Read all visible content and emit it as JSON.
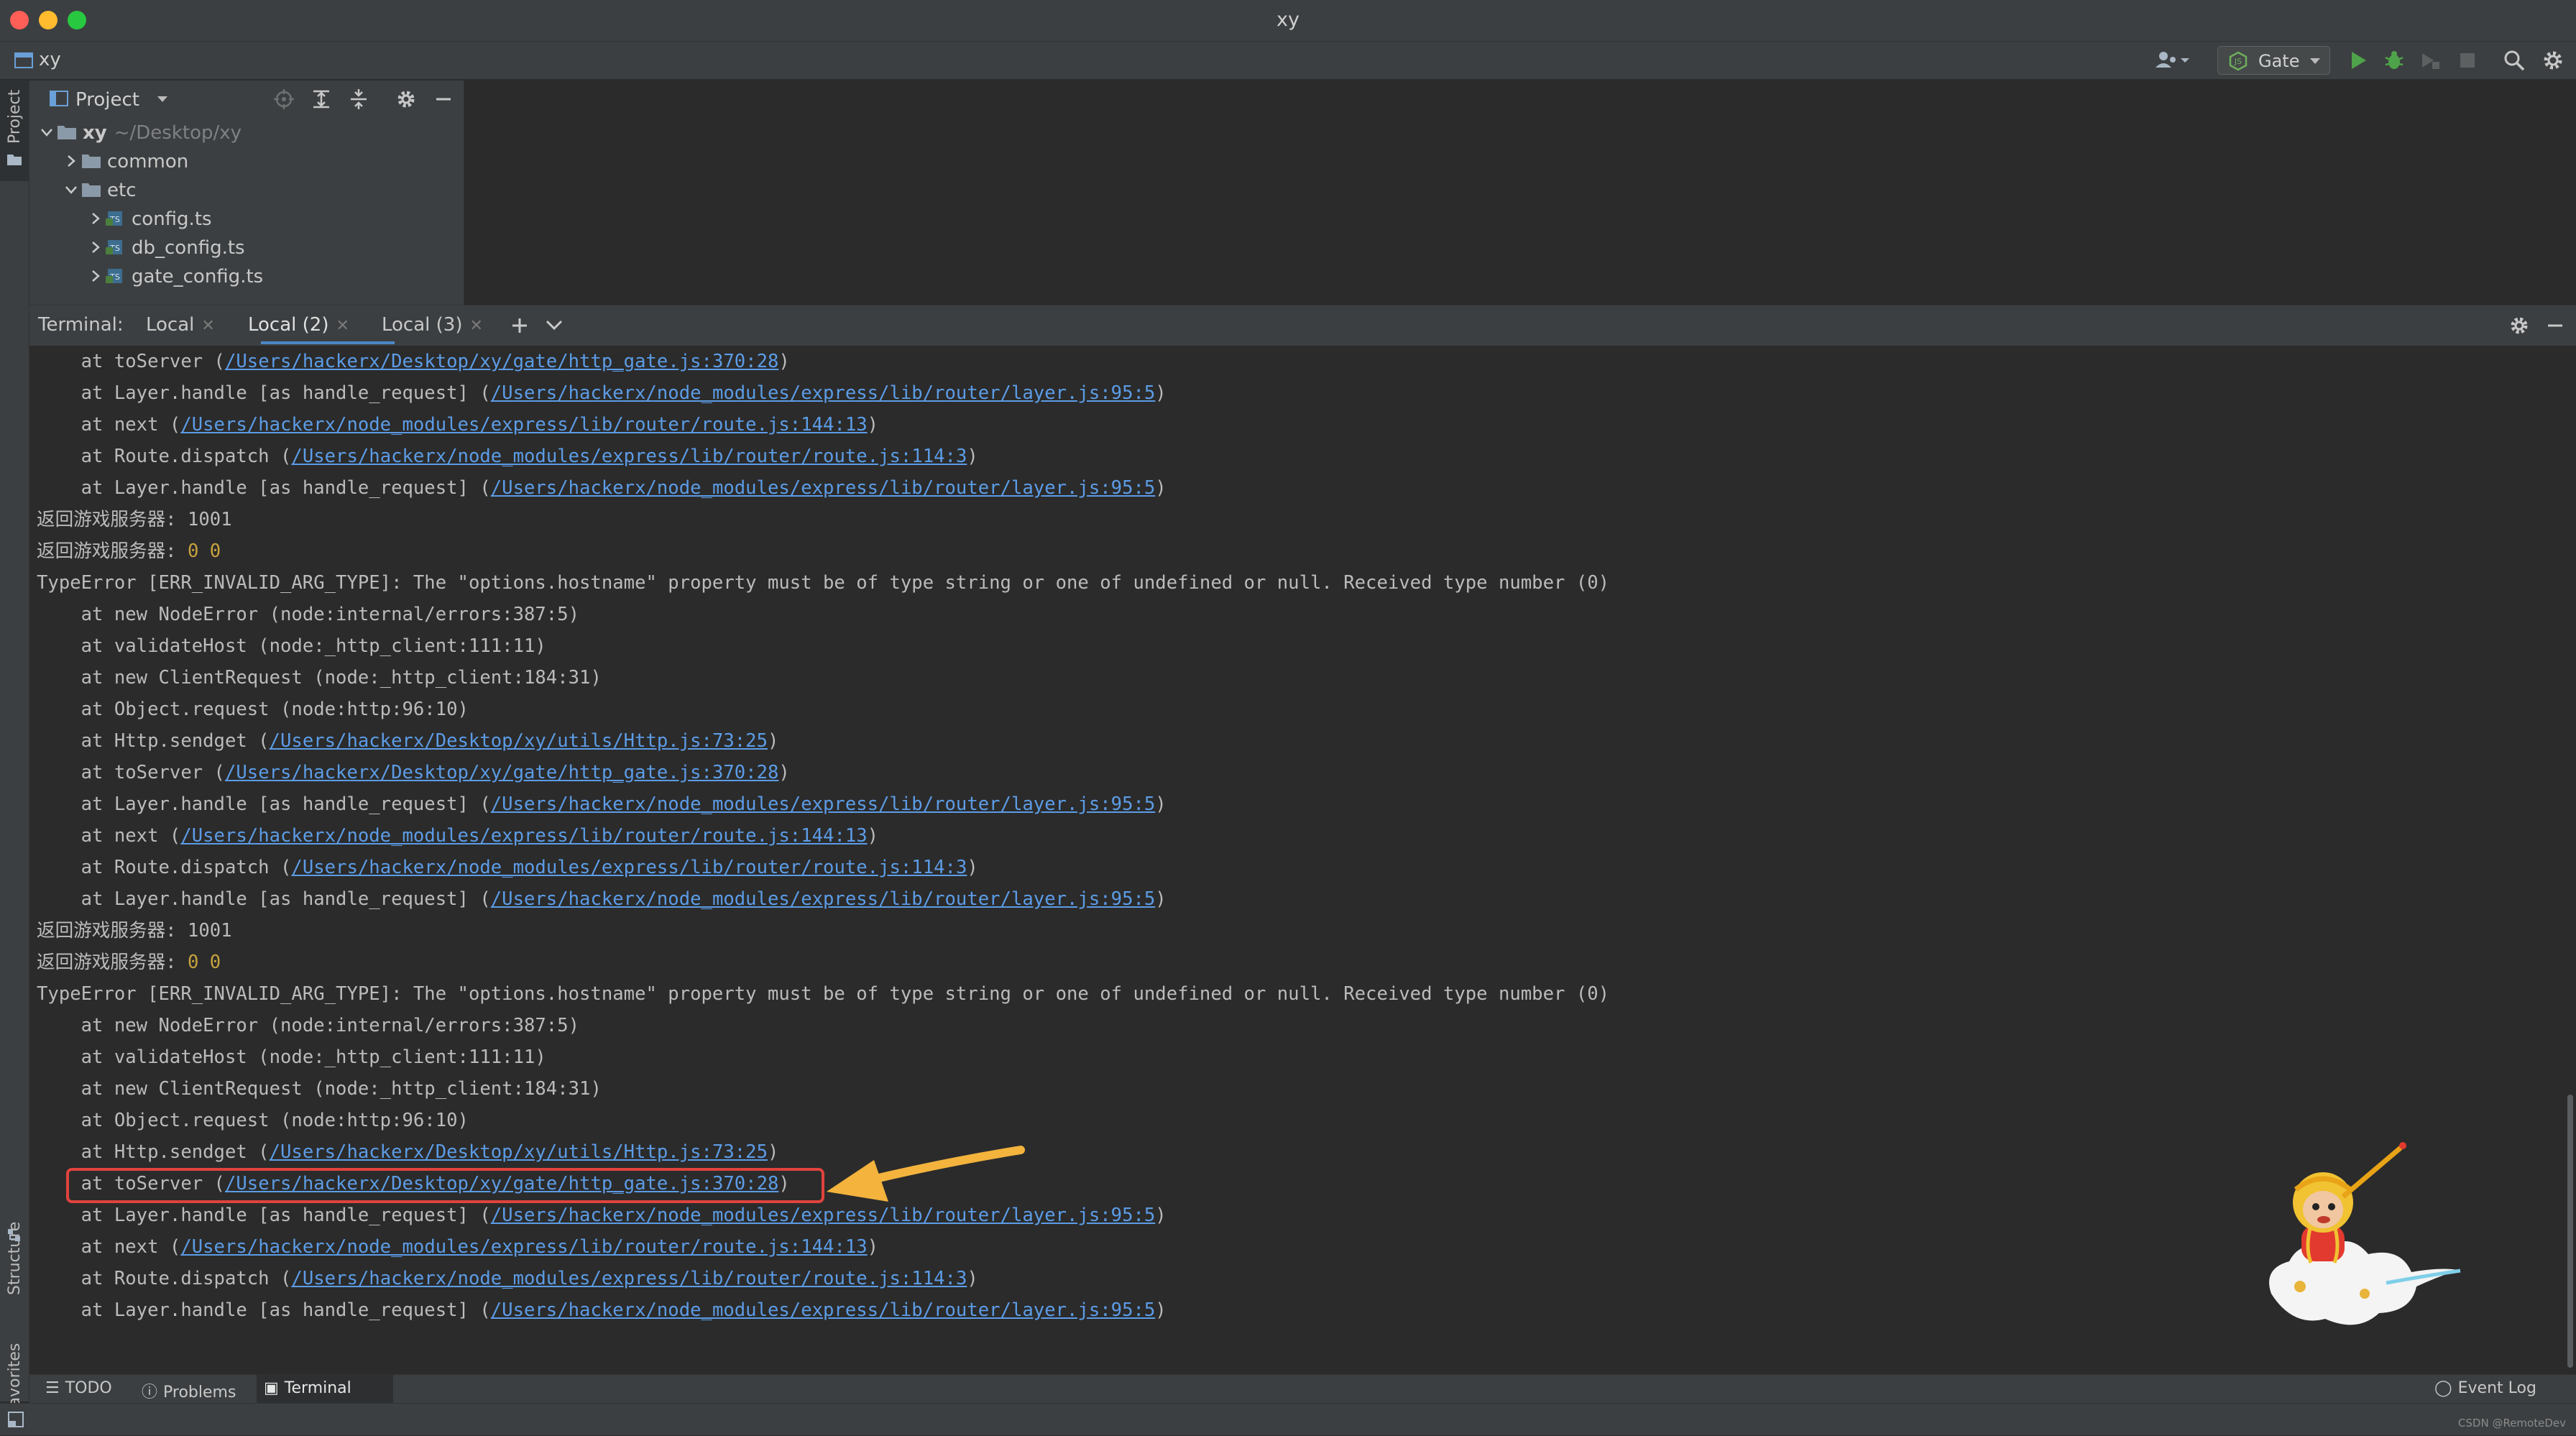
{
  "window": {
    "title": "xy"
  },
  "navbar": {
    "project_name": "xy",
    "run_config": "Gate"
  },
  "left_stripe": {
    "project_tab": "Project",
    "structure_tab": "Structure",
    "favorites_tab": "Favorites"
  },
  "project_panel": {
    "header": "Project",
    "tree": [
      {
        "name": "xy",
        "path": "~/Desktop/xy",
        "level": 0,
        "expanded": true,
        "type": "folder"
      },
      {
        "name": "common",
        "level": 1,
        "expanded": false,
        "type": "folder"
      },
      {
        "name": "etc",
        "level": 1,
        "expanded": true,
        "type": "folder"
      },
      {
        "name": "config.ts",
        "level": 2,
        "expanded": false,
        "type": "ts"
      },
      {
        "name": "db_config.ts",
        "level": 2,
        "expanded": false,
        "type": "ts"
      },
      {
        "name": "gate_config.ts",
        "level": 2,
        "expanded": false,
        "type": "ts"
      }
    ]
  },
  "terminal": {
    "label": "Terminal:",
    "tabs": [
      "Local",
      "Local (2)",
      "Local (3)"
    ],
    "active_tab": 1,
    "lines": [
      {
        "ind": "    ",
        "pre": "at toServer (",
        "link": "/Users/hackerx/Desktop/xy/gate/http_gate.js:370:28",
        "post": ")"
      },
      {
        "ind": "    ",
        "pre": "at Layer.handle [as handle_request] (",
        "link": "/Users/hackerx/node_modules/express/lib/router/layer.js:95:5",
        "post": ")"
      },
      {
        "ind": "    ",
        "pre": "at next (",
        "link": "/Users/hackerx/node_modules/express/lib/router/route.js:144:13",
        "post": ")"
      },
      {
        "ind": "    ",
        "pre": "at Route.dispatch (",
        "link": "/Users/hackerx/node_modules/express/lib/router/route.js:114:3",
        "post": ")"
      },
      {
        "ind": "    ",
        "pre": "at Layer.handle [as handle_request] (",
        "link": "/Users/hackerx/node_modules/express/lib/router/layer.js:95:5",
        "post": ")"
      },
      {
        "pre": "返回游戏服务器: 1001"
      },
      {
        "pre": "返回游戏服务器: ",
        "num": "0 0"
      },
      {
        "pre": "TypeError [ERR_INVALID_ARG_TYPE]: The \"options.hostname\" property must be of type string or one of undefined or null. Received type number (0)"
      },
      {
        "ind": "    ",
        "pre": "at new NodeError (node:internal/errors:387:5)"
      },
      {
        "ind": "    ",
        "pre": "at validateHost (node:_http_client:111:11)"
      },
      {
        "ind": "    ",
        "pre": "at new ClientRequest (node:_http_client:184:31)"
      },
      {
        "ind": "    ",
        "pre": "at Object.request (node:http:96:10)"
      },
      {
        "ind": "    ",
        "pre": "at Http.sendget (",
        "link": "/Users/hackerx/Desktop/xy/utils/Http.js:73:25",
        "post": ")"
      },
      {
        "ind": "    ",
        "pre": "at toServer (",
        "link": "/Users/hackerx/Desktop/xy/gate/http_gate.js:370:28",
        "post": ")"
      },
      {
        "ind": "    ",
        "pre": "at Layer.handle [as handle_request] (",
        "link": "/Users/hackerx/node_modules/express/lib/router/layer.js:95:5",
        "post": ")"
      },
      {
        "ind": "    ",
        "pre": "at next (",
        "link": "/Users/hackerx/node_modules/express/lib/router/route.js:144:13",
        "post": ")"
      },
      {
        "ind": "    ",
        "pre": "at Route.dispatch (",
        "link": "/Users/hackerx/node_modules/express/lib/router/route.js:114:3",
        "post": ")"
      },
      {
        "ind": "    ",
        "pre": "at Layer.handle [as handle_request] (",
        "link": "/Users/hackerx/node_modules/express/lib/router/layer.js:95:5",
        "post": ")"
      },
      {
        "pre": "返回游戏服务器: 1001"
      },
      {
        "pre": "返回游戏服务器: ",
        "num": "0 0"
      },
      {
        "pre": "TypeError [ERR_INVALID_ARG_TYPE]: The \"options.hostname\" property must be of type string or one of undefined or null. Received type number (0)"
      },
      {
        "ind": "    ",
        "pre": "at new NodeError (node:internal/errors:387:5)"
      },
      {
        "ind": "    ",
        "pre": "at validateHost (node:_http_client:111:11)"
      },
      {
        "ind": "    ",
        "pre": "at new ClientRequest (node:_http_client:184:31)"
      },
      {
        "ind": "    ",
        "pre": "at Object.request (node:http:96:10)"
      },
      {
        "ind": "    ",
        "pre": "at Http.sendget (",
        "link": "/Users/hackerx/Desktop/xy/utils/Http.js:73:25",
        "post": ")"
      },
      {
        "ind": "    ",
        "pre": "at toServer (",
        "link": "/Users/hackerx/Desktop/xy/gate/http_gate.js:370:28",
        "post": ")",
        "highlight": true
      },
      {
        "ind": "    ",
        "pre": "at Layer.handle [as handle_request] (",
        "link": "/Users/hackerx/node_modules/express/lib/router/layer.js:95:5",
        "post": ")"
      },
      {
        "ind": "    ",
        "pre": "at next (",
        "link": "/Users/hackerx/node_modules/express/lib/router/route.js:144:13",
        "post": ")"
      },
      {
        "ind": "    ",
        "pre": "at Route.dispatch (",
        "link": "/Users/hackerx/node_modules/express/lib/router/route.js:114:3",
        "post": ")"
      },
      {
        "ind": "    ",
        "pre": "at Layer.handle [as handle_request] (",
        "link": "/Users/hackerx/node_modules/express/lib/router/layer.js:95:5",
        "post": ")"
      }
    ]
  },
  "bottom_bar": {
    "todo": "TODO",
    "problems": "Problems",
    "terminal": "Terminal",
    "event_log": "Event Log"
  },
  "status_bar": {
    "watermark": "CSDN @RemoteDev"
  },
  "colors": {
    "link": "#5c9ce6",
    "number": "#c7a23e",
    "highlight": "#e0433d",
    "arrow": "#f3b33d",
    "run": "#4fa34a"
  }
}
